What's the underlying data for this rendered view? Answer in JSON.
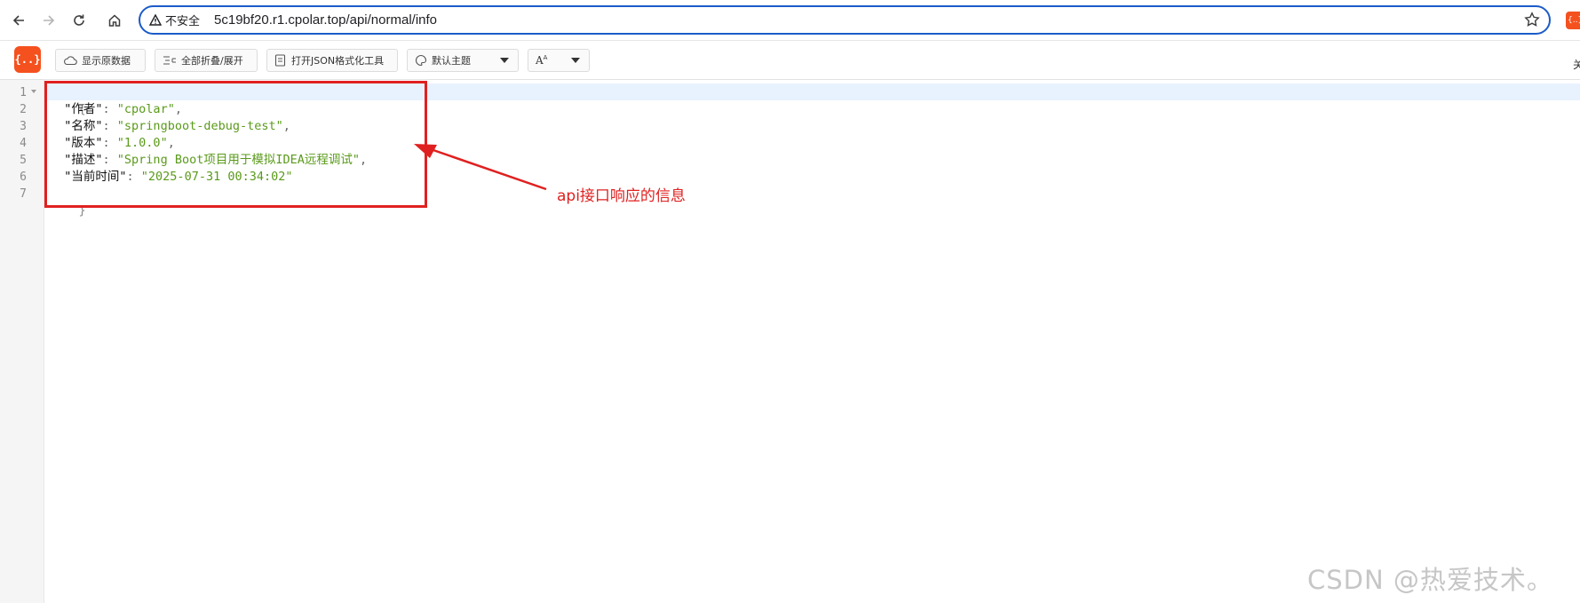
{
  "browser": {
    "security_label": "不安全",
    "url": "5c19bf20.r1.cpolar.top/api/normal/info",
    "extension_badge": "{..}"
  },
  "toolbar": {
    "logo": "{..}",
    "raw_data_label": "显示原数据",
    "collapse_expand_label": "全部折叠/展开",
    "open_formatter_label": "打开JSON格式化工具",
    "theme_label": "默认主题",
    "font_label": "A",
    "right_glyph": "关"
  },
  "editor": {
    "line_numbers": [
      "1",
      "2",
      "3",
      "4",
      "5",
      "6",
      "7"
    ],
    "open_brace": "{",
    "close_brace": "}",
    "entries": [
      {
        "key": "\"作者\"",
        "value": "\"cpolar\"",
        "comma": ","
      },
      {
        "key": "\"名称\"",
        "value": "\"springboot-debug-test\"",
        "comma": ","
      },
      {
        "key": "\"版本\"",
        "value": "\"1.0.0\"",
        "comma": ","
      },
      {
        "key": "\"描述\"",
        "value": "\"Spring Boot项目用于模拟IDEA远程调试\"",
        "comma": ","
      },
      {
        "key": "\"当前时间\"",
        "value": "\"2025-07-31 00:34:02\"",
        "comma": ""
      }
    ]
  },
  "annotation": {
    "label": "api接口响应的信息",
    "color": "#e02020"
  },
  "watermark": "CSDN @热爱技术。",
  "colors": {
    "accent_orange": "#f4511e",
    "omnibox_border": "#1b5bc7",
    "string_green": "#5a9a1a"
  }
}
